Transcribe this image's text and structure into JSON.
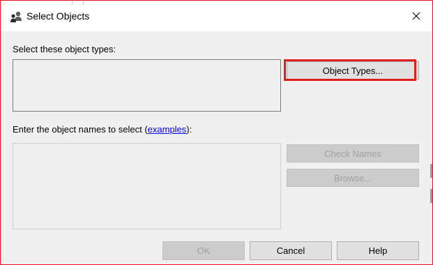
{
  "window": {
    "title": "Select Objects",
    "title_icon": "users-icon",
    "close_icon": "close-icon"
  },
  "object_types": {
    "label": "Select these object types:",
    "button_label": "Object Types..."
  },
  "object_names": {
    "label_prefix": "Enter the object names to select (",
    "link_text": "examples",
    "label_suffix": "):",
    "check_names_label": "Check Names",
    "browse_label": "Browse..."
  },
  "footer": {
    "ok_label": "OK",
    "cancel_label": "Cancel",
    "help_label": "Help"
  },
  "colors": {
    "highlight": "#e01e1e",
    "link": "#0000ee",
    "dialog_bg": "#f0f0f0"
  }
}
